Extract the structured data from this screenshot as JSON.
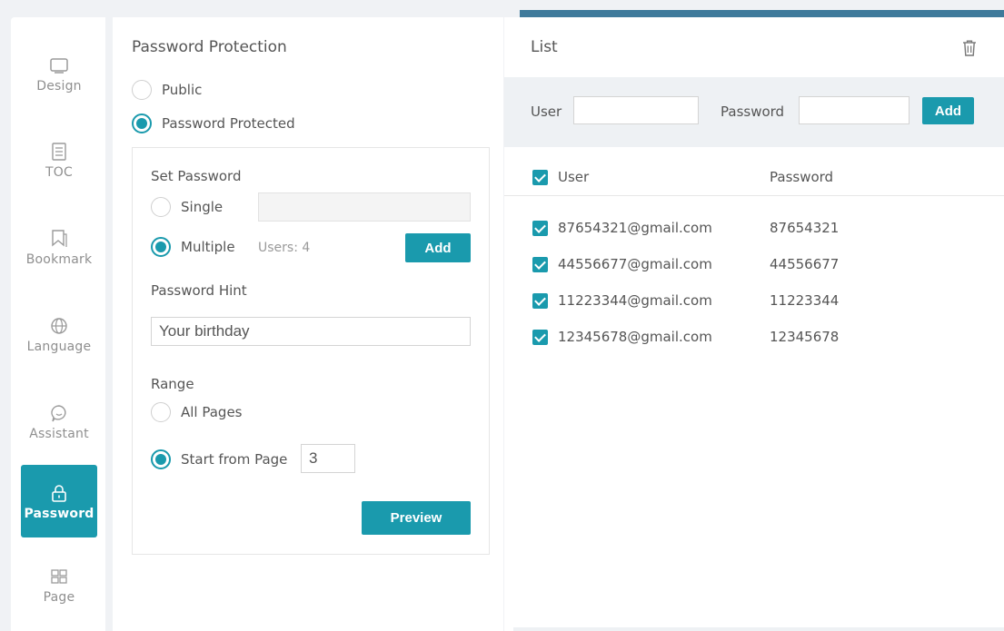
{
  "sidebar": {
    "items": [
      {
        "label": "Design",
        "icon": "design-icon"
      },
      {
        "label": "TOC",
        "icon": "toc-icon"
      },
      {
        "label": "Bookmark",
        "icon": "bookmark-icon"
      },
      {
        "label": "Language",
        "icon": "globe-icon"
      },
      {
        "label": "Assistant",
        "icon": "chat-icon"
      },
      {
        "label": "Password",
        "icon": "lock-icon",
        "active": true
      },
      {
        "label": "Page",
        "icon": "grid-icon"
      }
    ]
  },
  "protection": {
    "title": "Password Protection",
    "public_label": "Public",
    "protected_label": "Password Protected",
    "selected": "protected",
    "set_password_label": "Set Password",
    "single_label": "Single",
    "multiple_label": "Multiple",
    "users_count": "Users: 4",
    "add_label": "Add",
    "hint_label": "Password Hint",
    "hint_value": "Your birthday",
    "range_label": "Range",
    "all_pages_label": "All Pages",
    "start_from_label": "Start from Page",
    "start_page_value": "3",
    "preview_label": "Preview"
  },
  "list": {
    "title": "List",
    "user_label": "User",
    "password_label": "Password",
    "add_label": "Add",
    "col_user": "User",
    "col_password": "Password",
    "rows": [
      {
        "user": "87654321@gmail.com",
        "password": "87654321"
      },
      {
        "user": "44556677@gmail.com",
        "password": "44556677"
      },
      {
        "user": "11223344@gmail.com",
        "password": "11223344"
      },
      {
        "user": "12345678@gmail.com",
        "password": "12345678"
      }
    ]
  },
  "colors": {
    "accent": "#1a9aad",
    "topbar": "#3f7a9b",
    "background": "#f0f2f5"
  }
}
